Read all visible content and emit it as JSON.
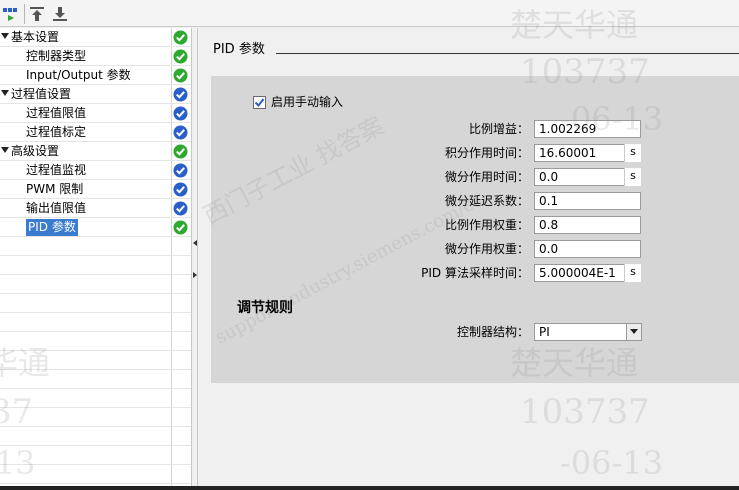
{
  "toolbar": {
    "buttons": [
      {
        "name": "view-toggle-icon"
      },
      {
        "name": "move-up-icon"
      },
      {
        "name": "move-down-icon"
      }
    ]
  },
  "tree": {
    "items": [
      {
        "label": "基本设置",
        "level": 0,
        "expanded": true,
        "status": "ok",
        "color": "#2fa82f"
      },
      {
        "label": "控制器类型",
        "level": 1,
        "status": "ok",
        "color": "#2fa82f"
      },
      {
        "label": "Input/Output 参数",
        "level": 1,
        "status": "ok",
        "color": "#2fa82f"
      },
      {
        "label": "过程值设置",
        "level": 0,
        "expanded": true,
        "status": "default",
        "color": "#2a5fc8"
      },
      {
        "label": "过程值限值",
        "level": 1,
        "status": "default",
        "color": "#2a5fc8"
      },
      {
        "label": "过程值标定",
        "level": 1,
        "status": "default",
        "color": "#2a5fc8"
      },
      {
        "label": "高级设置",
        "level": 0,
        "expanded": true,
        "status": "ok",
        "color": "#2fa82f"
      },
      {
        "label": "过程值监视",
        "level": 1,
        "status": "default",
        "color": "#2a5fc8"
      },
      {
        "label": "PWM 限制",
        "level": 1,
        "status": "default",
        "color": "#2a5fc8"
      },
      {
        "label": "输出值限值",
        "level": 1,
        "status": "default",
        "color": "#2a5fc8"
      },
      {
        "label": "PID 参数",
        "level": 1,
        "status": "ok",
        "color": "#2fa82f",
        "selected": true
      }
    ]
  },
  "main": {
    "section_title": "PID 参数",
    "manual_entry": {
      "label": "启用手动输入",
      "checked": true
    },
    "params": [
      {
        "label": "比例增益：",
        "value": "1.002269",
        "unit": ""
      },
      {
        "label": "积分作用时间：",
        "value": "16.60001",
        "unit": "s"
      },
      {
        "label": "微分作用时间：",
        "value": "0.0",
        "unit": "s"
      },
      {
        "label": "微分延迟系数：",
        "value": "0.1",
        "unit": ""
      },
      {
        "label": "比例作用权重：",
        "value": "0.8",
        "unit": ""
      },
      {
        "label": "微分作用权重：",
        "value": "0.0",
        "unit": ""
      },
      {
        "label": "PID 算法采样时间：",
        "value": "5.000004E-1",
        "unit": "s"
      }
    ],
    "tuning_rules": {
      "title": "调节规则",
      "structure_label": "控制器结构：",
      "structure_value": "PI"
    }
  },
  "colors": {
    "ok": "#2fa82f",
    "default": "#2a5fc8",
    "selection": "#3b7bd0",
    "panel": "#d6d6d6"
  }
}
